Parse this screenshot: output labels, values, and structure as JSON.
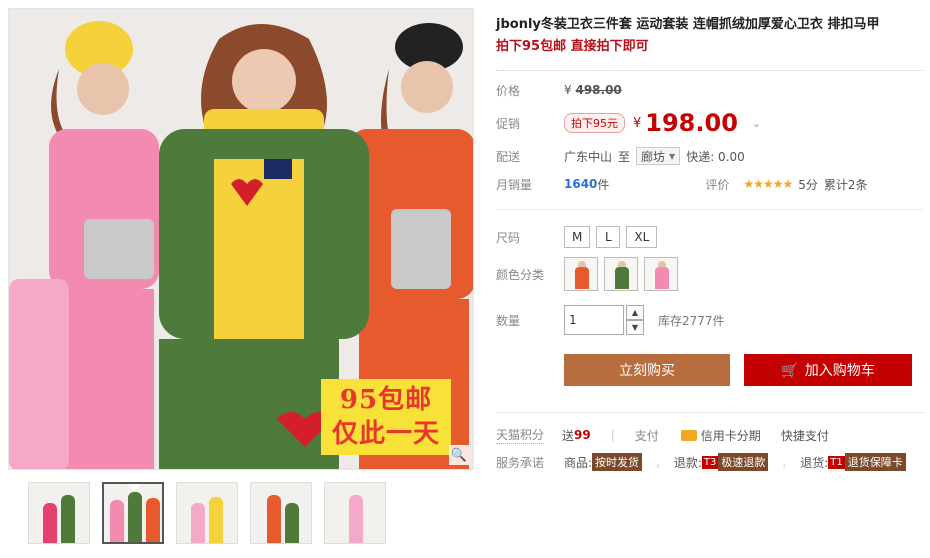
{
  "product": {
    "title": "jbonly冬装卫衣三件套 运动套装 连帽抓绒加厚爱心卫衣 排扣马甲",
    "subtitle": "拍下95包邮 直接拍下即可"
  },
  "gallery": {
    "promo_line1": "95包邮",
    "promo_line2": "仅此一天",
    "zoom_icon": "magnifier-icon",
    "thumbnails": [
      {
        "colors": [
          "#e7406e",
          "#4e7a3c"
        ]
      },
      {
        "colors": [
          "#f28ab2",
          "#4e7a3c",
          "#e65a2e"
        ]
      },
      {
        "colors": [
          "#f5a8c8",
          "#f5d23b"
        ]
      },
      {
        "colors": [
          "#e65a2e",
          "#4e7a3c"
        ]
      },
      {
        "colors": [
          "#f5a8c8"
        ]
      }
    ]
  },
  "price": {
    "label": "价格",
    "currency": "¥",
    "original": "498.00",
    "promo_label": "促销",
    "promo_tag": "拍下95元",
    "promo_price": "198.00"
  },
  "shipping": {
    "label": "配送",
    "from": "广东中山",
    "to_word": "至",
    "destination": "廊坊",
    "express": "快递: 0.00"
  },
  "sales": {
    "label": "月销量",
    "count": "1640",
    "unit": "件",
    "rating_label": "评价",
    "stars": "★★★★★",
    "score": "5分",
    "reviews": "累计2条"
  },
  "sku": {
    "size_label": "尺码",
    "sizes": [
      "M",
      "L",
      "XL"
    ],
    "color_label": "颜色分类",
    "colors": [
      {
        "name": "orange",
        "hex": "#e65a2e"
      },
      {
        "name": "green",
        "hex": "#4e7a3c"
      },
      {
        "name": "pink",
        "hex": "#f28ab2"
      }
    ]
  },
  "quantity": {
    "label": "数量",
    "value": "1",
    "stock": "库存2777件"
  },
  "actions": {
    "buy_now": "立刻购买",
    "add_to_cart": "加入购物车"
  },
  "footer": {
    "points_label": "天猫积分",
    "points_prefix": "送",
    "points_value": "99",
    "pay_label": "支付",
    "credit": "信用卡分期",
    "express_pay": "快捷支付",
    "service_label": "服务承诺",
    "goods_prefix": "商品:",
    "goods_tag": "按时发货",
    "refund_prefix": "退款:",
    "refund_code": "T3",
    "refund_tag": "极速退款",
    "return_prefix": "退货:",
    "return_code": "T1",
    "return_tag": "退货保障卡"
  },
  "colors": {
    "accent_red": "#c40000",
    "buy_brown": "#b86d3e"
  }
}
